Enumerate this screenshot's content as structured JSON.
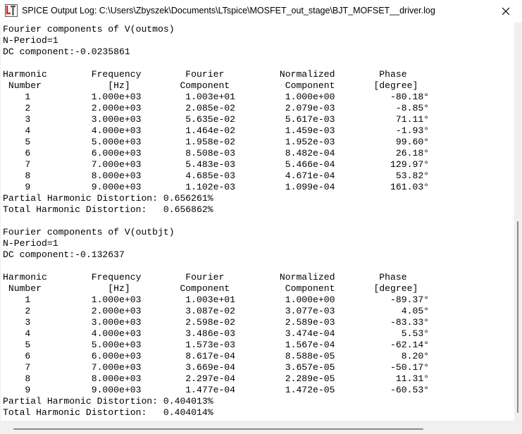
{
  "window": {
    "title": "SPICE Output Log: C:\\Users\\Zbyszek\\Documents\\LTspice\\MOSFET_out_stage\\BJT_MOFSET__driver.log",
    "icon": "ltspice-app-icon",
    "close_icon": "close-icon"
  },
  "log": {
    "text": "Fourier components of V(outmos)\nN-Period=1\nDC component:-0.0235861\n\nHarmonic        Frequency        Fourier          Normalized        Phase\n Number            [Hz]         Component          Component       [degree]\n    1           1.000e+03        1.003e+01         1.000e+00          -80.18°\n    2           2.000e+03        2.085e-02         2.079e-03           -8.85°\n    3           3.000e+03        5.635e-02         5.617e-03           71.11°\n    4           4.000e+03        1.464e-02         1.459e-03           -1.93°\n    5           5.000e+03        1.958e-02         1.952e-03           99.60°\n    6           6.000e+03        8.508e-03         8.482e-04           26.18°\n    7           7.000e+03        5.483e-03         5.466e-04          129.97°\n    8           8.000e+03        4.685e-03         4.671e-04           53.82°\n    9           9.000e+03        1.102e-03         1.099e-04          161.03°\nPartial Harmonic Distortion: 0.656261%\nTotal Harmonic Distortion:   0.656862%\n\nFourier components of V(outbjt)\nN-Period=1\nDC component:-0.132637\n\nHarmonic        Frequency        Fourier          Normalized        Phase\n Number            [Hz]         Component          Component       [degree]\n    1           1.000e+03        1.003e+01         1.000e+00          -89.37°\n    2           2.000e+03        3.087e-02         3.077e-03            4.05°\n    3           3.000e+03        2.598e-02         2.589e-03          -83.33°\n    4           4.000e+03        3.486e-03         3.474e-04            5.53°\n    5           5.000e+03        1.573e-03         1.567e-04          -62.14°\n    6           6.000e+03        8.617e-04         8.588e-05            8.20°\n    7           7.000e+03        3.669e-04         3.657e-05          -50.17°\n    8           8.000e+03        2.297e-04         2.289e-05           11.31°\n    9           9.000e+03        1.477e-04         1.472e-05          -60.53°\nPartial Harmonic Distortion: 0.404013%\nTotal Harmonic Distortion:   0.404014%"
  },
  "colors": {
    "icon_red": "#d6261f",
    "icon_dark": "#5a5a5a"
  }
}
